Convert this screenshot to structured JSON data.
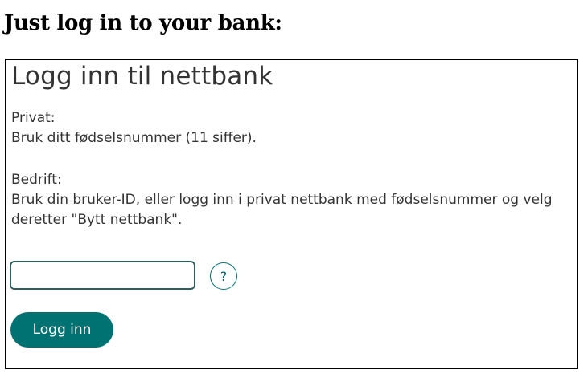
{
  "page": {
    "heading": "Just log in to your bank:"
  },
  "login": {
    "title": "Logg inn til nettbank",
    "private_label": "Privat:",
    "private_desc": "Bruk ditt fødselsnummer (11 siffer).",
    "business_label": "Bedrift:",
    "business_desc": "Bruk din bruker-ID, eller logg inn i privat nettbank med fødselsnummer og velg deretter \"Bytt nettbank\".",
    "input_value": "",
    "help_label": "?",
    "submit_label": "Logg inn"
  },
  "colors": {
    "accent": "#007272",
    "text": "#333333",
    "input_border": "#2f5e5c"
  }
}
